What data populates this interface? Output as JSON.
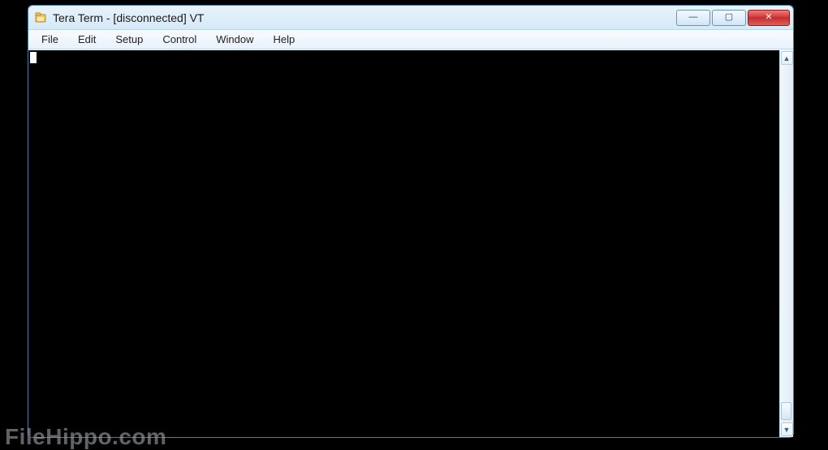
{
  "window": {
    "title": "Tera Term - [disconnected] VT",
    "controls": {
      "minimize_glyph": "—",
      "maximize_glyph": "▢",
      "close_glyph": "✕"
    }
  },
  "menubar": {
    "items": [
      {
        "label": "File"
      },
      {
        "label": "Edit"
      },
      {
        "label": "Setup"
      },
      {
        "label": "Control"
      },
      {
        "label": "Window"
      },
      {
        "label": "Help"
      }
    ]
  },
  "terminal": {
    "content": ""
  },
  "scrollbar": {
    "up_glyph": "▲",
    "down_glyph": "▼"
  },
  "watermark": "FileHippo.com"
}
